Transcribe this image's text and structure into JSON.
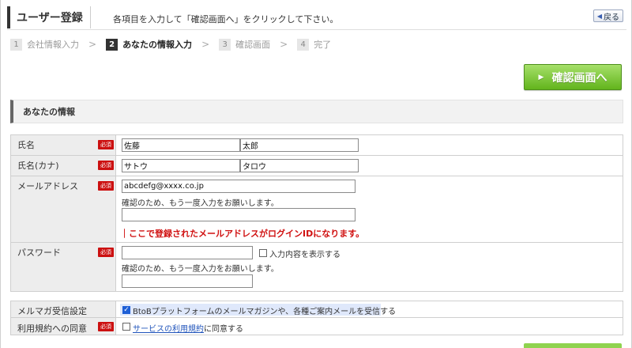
{
  "header": {
    "title": "ユーザー登録",
    "description": "各項目を入力して「確認画面へ」をクリックして下さい。",
    "back_label": "戻る"
  },
  "steps": [
    {
      "num": "1",
      "label": "会社情報入力",
      "active": false
    },
    {
      "num": "2",
      "label": "あなたの情報入力",
      "active": true
    },
    {
      "num": "3",
      "label": "確認画面",
      "active": false
    },
    {
      "num": "4",
      "label": "完了",
      "active": false
    }
  ],
  "confirm_label": "確認画面へ",
  "section_title": "あなたの情報",
  "required_badge": "必須",
  "fields": {
    "name": {
      "label": "氏名",
      "last": "佐藤",
      "first": "太郎"
    },
    "kana": {
      "label": "氏名(カナ)",
      "last": "サトウ",
      "first": "タロウ"
    },
    "email": {
      "label": "メールアドレス",
      "value": "abcdefg@xxxx.co.jp",
      "confirm_note": "確認のため、もう一度入力をお願いします。",
      "confirm_value": "",
      "warning": "｜ここで登録されたメールアドレスがログインIDになります。"
    },
    "password": {
      "label": "パスワード",
      "value": "",
      "show_label": "入力内容を表示する",
      "show_checked": false,
      "confirm_note": "確認のため、もう一度入力をお願いします。",
      "confirm_value": ""
    }
  },
  "settings": {
    "newsletter": {
      "label": "メルマガ受信設定",
      "checked": true,
      "text": "BtoBプラットフォームのメールマガジンや、各種ご案内メールを受信する"
    },
    "terms": {
      "label": "利用規約への同意",
      "checked": false,
      "link_text": "サービスの利用規約",
      "suffix": "に同意する"
    }
  }
}
